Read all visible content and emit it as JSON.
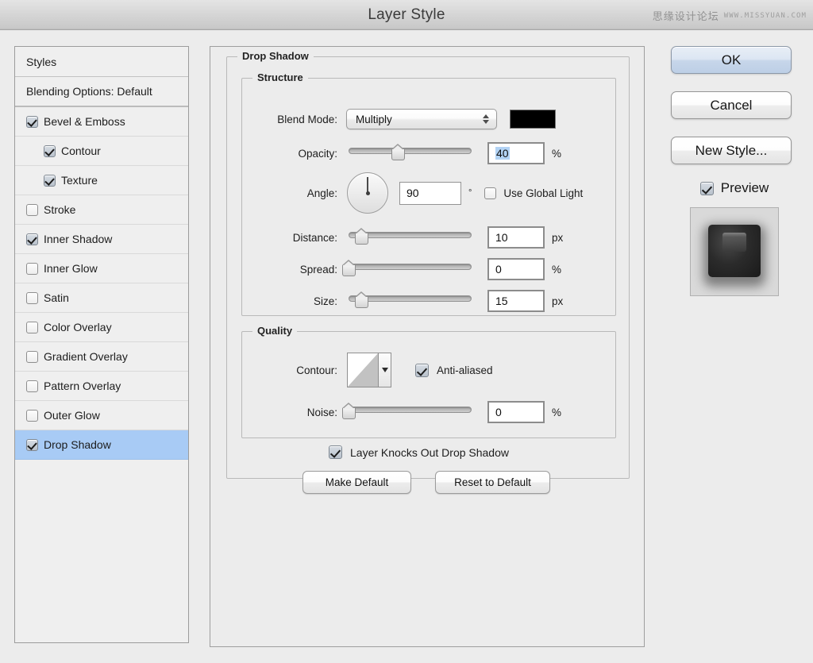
{
  "window": {
    "title": "Layer Style",
    "watermark_cn": "思缘设计论坛",
    "watermark_en": "WWW.MISSYUAN.COM"
  },
  "sidebar": {
    "header": "Styles",
    "blending_options": "Blending Options: Default",
    "items": [
      {
        "label": "Bevel & Emboss",
        "checked": true,
        "indent": false,
        "selected": false
      },
      {
        "label": "Contour",
        "checked": true,
        "indent": true,
        "selected": false
      },
      {
        "label": "Texture",
        "checked": true,
        "indent": true,
        "selected": false
      },
      {
        "label": "Stroke",
        "checked": false,
        "indent": false,
        "selected": false
      },
      {
        "label": "Inner Shadow",
        "checked": true,
        "indent": false,
        "selected": false
      },
      {
        "label": "Inner Glow",
        "checked": false,
        "indent": false,
        "selected": false
      },
      {
        "label": "Satin",
        "checked": false,
        "indent": false,
        "selected": false
      },
      {
        "label": "Color Overlay",
        "checked": false,
        "indent": false,
        "selected": false
      },
      {
        "label": "Gradient Overlay",
        "checked": false,
        "indent": false,
        "selected": false
      },
      {
        "label": "Pattern Overlay",
        "checked": false,
        "indent": false,
        "selected": false
      },
      {
        "label": "Outer Glow",
        "checked": false,
        "indent": false,
        "selected": false
      },
      {
        "label": "Drop Shadow",
        "checked": true,
        "indent": false,
        "selected": true
      }
    ]
  },
  "main": {
    "group_title": "Drop Shadow",
    "structure": {
      "title": "Structure",
      "blend_mode_label": "Blend Mode:",
      "blend_mode_value": "Multiply",
      "shadow_color": "#000000",
      "opacity_label": "Opacity:",
      "opacity_value": "40",
      "opacity_unit": "%",
      "opacity_slider_pct": 40,
      "angle_label": "Angle:",
      "angle_value": "90",
      "angle_unit": "°",
      "use_global_light_label": "Use Global Light",
      "use_global_light_checked": false,
      "distance_label": "Distance:",
      "distance_value": "10",
      "distance_unit": "px",
      "distance_slider_pct": 10,
      "spread_label": "Spread:",
      "spread_value": "0",
      "spread_unit": "%",
      "spread_slider_pct": 0,
      "size_label": "Size:",
      "size_value": "15",
      "size_unit": "px",
      "size_slider_pct": 10
    },
    "quality": {
      "title": "Quality",
      "contour_label": "Contour:",
      "anti_aliased_label": "Anti-aliased",
      "anti_aliased_checked": true,
      "noise_label": "Noise:",
      "noise_value": "0",
      "noise_unit": "%",
      "noise_slider_pct": 0
    },
    "knockout_label": "Layer Knocks Out Drop Shadow",
    "knockout_checked": true,
    "make_default_label": "Make Default",
    "reset_default_label": "Reset to Default"
  },
  "right": {
    "ok_label": "OK",
    "cancel_label": "Cancel",
    "new_style_label": "New Style...",
    "preview_label": "Preview",
    "preview_checked": true
  },
  "colors": {
    "selection_blue": "#a8cbf5",
    "text_highlight": "#b2d3f5",
    "dialog_bg": "#ececec"
  }
}
